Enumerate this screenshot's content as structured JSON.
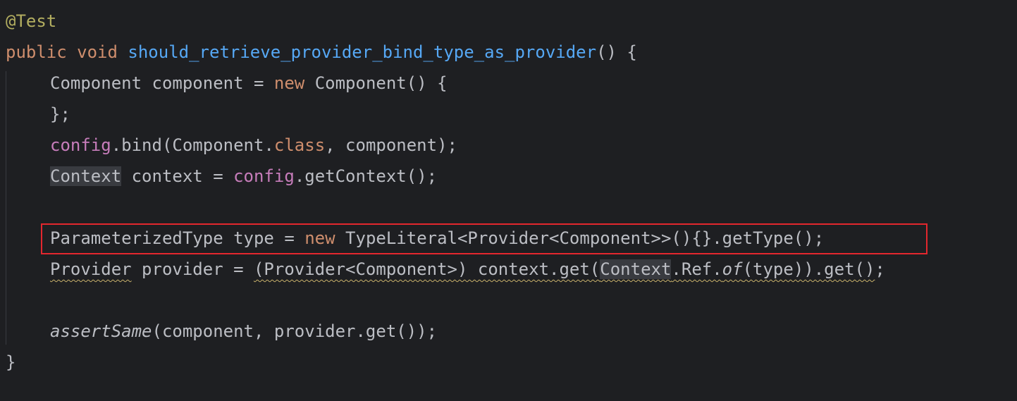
{
  "code": {
    "l1": {
      "annotation": "@Test"
    },
    "l2": {
      "kw_public": "public",
      "sp1": " ",
      "kw_void": "void",
      "sp2": " ",
      "method": "should_retrieve_provider_bind_type_as_provider",
      "rest": "() {"
    },
    "l3": {
      "a": "Component component = ",
      "kw_new": "new",
      "b": " Component() {"
    },
    "l4": {
      "a": "};"
    },
    "l5": {
      "field": "config",
      "a": ".bind(Component.",
      "kw_class": "class",
      "b": ", component);"
    },
    "l6": {
      "type": "Context",
      "a": " context = ",
      "field": "config",
      "b": ".getContext();"
    },
    "l8": {
      "a": "ParameterizedType type = ",
      "kw_new": "new",
      "b": " TypeLiteral<Provider<Component>>(){}.getType();"
    },
    "l9": {
      "type": "Provider",
      "a": " provider = ",
      "cast": "(Provider<Component>) context.get(",
      "ctx": "Context",
      "ref": ".Ref.",
      "of": "of",
      "end": "(type)).get()",
      "semi": ";"
    },
    "l11": {
      "method": "assertSame",
      "a": "(component, provider.get());"
    },
    "l12": {
      "a": "}"
    }
  },
  "colors": {
    "background": "#1e1f22",
    "text": "#bcbec4",
    "keyword": "#cf8e6d",
    "annotation": "#b3ae60",
    "method_declaration": "#56a8f5",
    "field": "#c77dbb",
    "highlight_box": "#e3272e",
    "warning_underline": "#c9b26b"
  }
}
